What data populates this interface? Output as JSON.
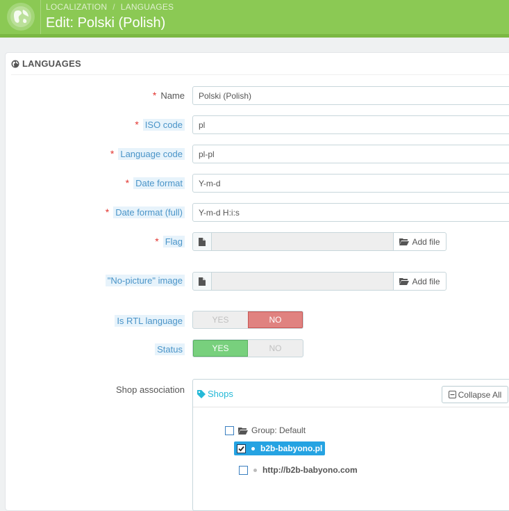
{
  "header": {
    "breadcrumb": [
      "LOCALIZATION",
      "LANGUAGES"
    ],
    "breadcrumb_separator": "/",
    "title": "Edit: Polski (Polish)",
    "icon": "globe-icon"
  },
  "panel": {
    "heading": "LANGUAGES",
    "heading_icon": "globe-icon"
  },
  "form": {
    "name": {
      "label": "Name",
      "value": "Polski (Polish)",
      "required": true
    },
    "iso_code": {
      "label": "ISO code",
      "value": "pl",
      "required": true
    },
    "language_code": {
      "label": "Language code",
      "value": "pl-pl",
      "required": true
    },
    "date_format": {
      "label": "Date format",
      "value": "Y-m-d",
      "required": true
    },
    "date_format_full": {
      "label": "Date format (full)",
      "value": "Y-m-d H:i:s",
      "required": true
    },
    "flag": {
      "label": "Flag",
      "button": "Add file",
      "required": true
    },
    "no_picture": {
      "label": "\"No-picture\" image",
      "button": "Add file"
    },
    "is_rtl": {
      "label": "Is RTL language",
      "yes": "YES",
      "no": "NO",
      "selected": "NO"
    },
    "status": {
      "label": "Status",
      "yes": "YES",
      "no": "NO",
      "selected": "YES"
    },
    "shop_association": {
      "label": "Shop association"
    },
    "required_marker": "*"
  },
  "shops_tree": {
    "title": "Shops",
    "collapse_label": "Collapse All",
    "group": {
      "label": "Group: Default",
      "checked": false
    },
    "shops": [
      {
        "label": "b2b-babyono.pl",
        "checked": true
      },
      {
        "label": "http://b2b-babyono.com",
        "checked": false
      }
    ]
  },
  "colors": {
    "header_green": "#8bc954",
    "required_red": "#e2342f",
    "hint_blue": "#4a94c8",
    "switch_no_red": "#e08280",
    "switch_yes_green": "#78d07d",
    "selected_blue": "#25a3e2"
  }
}
